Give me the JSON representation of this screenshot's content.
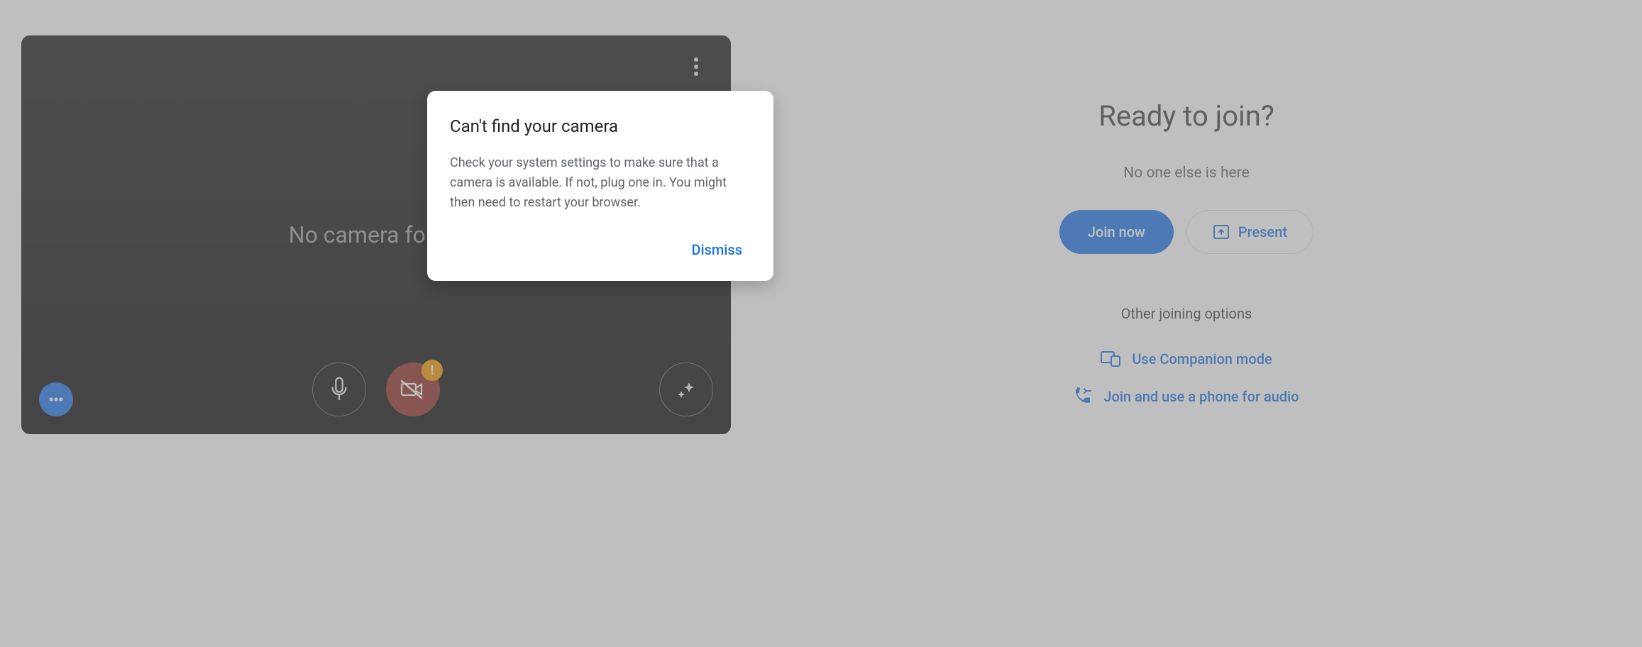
{
  "video": {
    "no_camera_text": "No camera found"
  },
  "dialog": {
    "title": "Can't find your camera",
    "body": "Check your system settings to make sure that a camera is available. If not, plug one in. You might then need to restart your browser.",
    "dismiss": "Dismiss"
  },
  "join": {
    "heading": "Ready to join?",
    "status": "No one else is here",
    "join_button": "Join now",
    "present_button": "Present",
    "other_options_heading": "Other joining options",
    "companion_link": "Use Companion mode",
    "phone_link": "Join and use a phone for audio"
  },
  "controls": {
    "alert_badge": "!"
  }
}
